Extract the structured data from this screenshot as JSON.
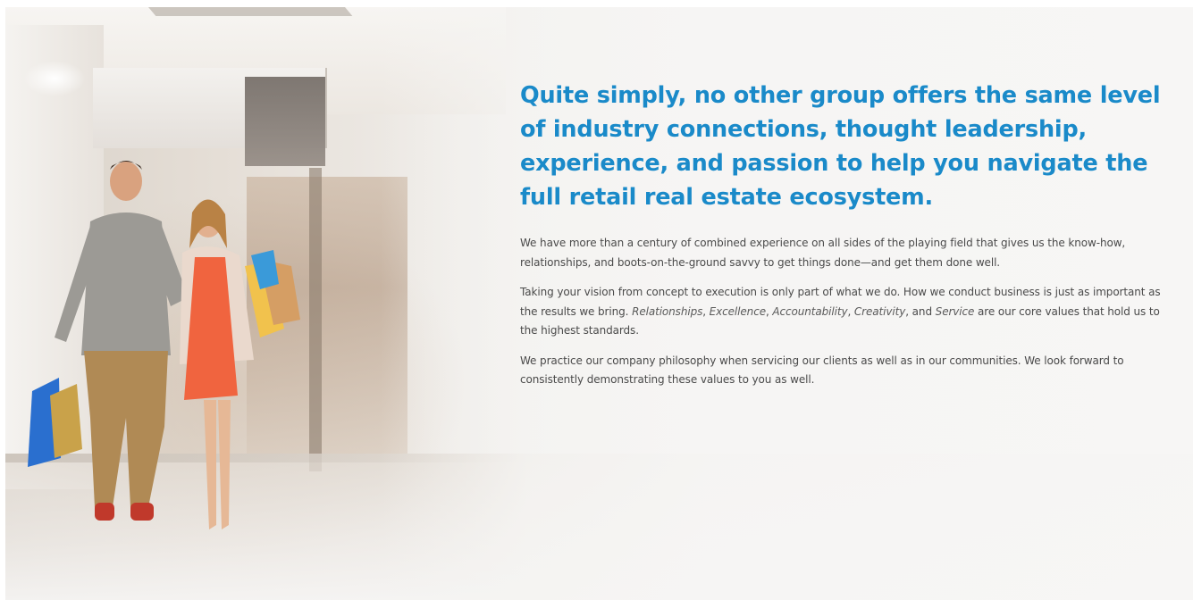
{
  "hero": {
    "image_alt": "couple-shopping-mall-photo",
    "headline": "Quite simply, no other group offers the same level of industry connections, thought leadership, experience, and passion to help you navigate the full retail real estate ecosystem.",
    "paragraph_1": "We have more than a century of combined experience on all sides of the playing field that gives us the know-how, relationships, and boots-on-the-ground savvy to get things done—and get them done well.",
    "paragraph_2": {
      "lead": "Taking your vision from concept to execution is only part of what we do. How we conduct business is just as important as the results we bring. ",
      "values": [
        "Relationships",
        "Excellence",
        "Accountability",
        "Creativity",
        "Service"
      ],
      "sep_1": ", ",
      "sep_2": ", ",
      "sep_3": ", ",
      "sep_4": ", and ",
      "tail": " are our core values that hold us to the highest standards."
    },
    "paragraph_3": "We practice our company philosophy when servicing our clients as well as in our communities. We look forward to consistently demonstrating these values to you as well."
  },
  "colors": {
    "headline": "#1a8ac9",
    "body_text": "#4a4a4a"
  }
}
